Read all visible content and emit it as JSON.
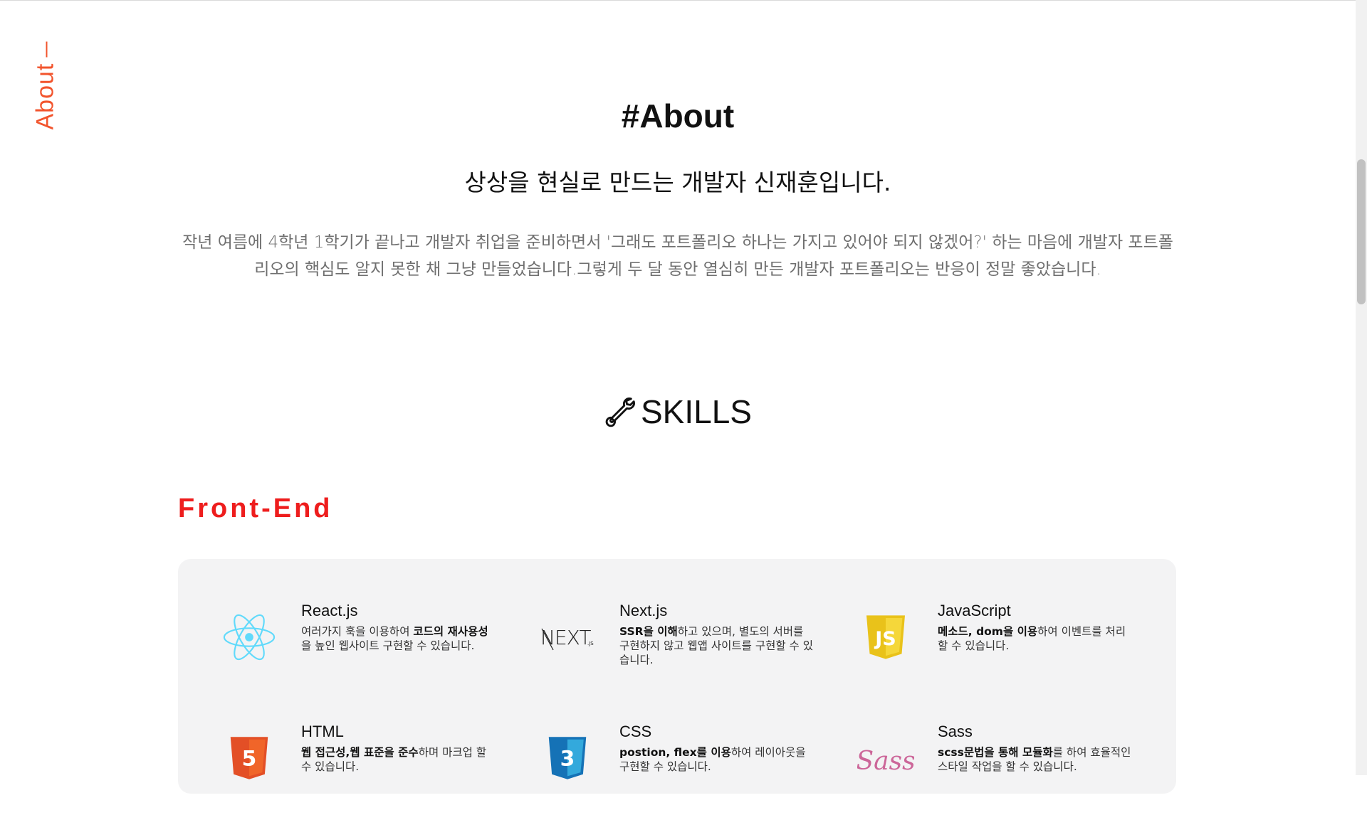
{
  "side_nav": {
    "label": "About"
  },
  "about": {
    "title": "#About",
    "subtitle": "상상을 현실로 만드는 개발자 신재훈입니다.",
    "description": "작년 여름에 4학년 1학기가 끝나고 개발자 취업을 준비하면서 '그래도 포트폴리오 하나는 가지고 있어야 되지 않겠어?' 하는 마음에 개발자 포트폴리오의 핵심도 알지 못한 채 그냥 만들었습니다.그렇게 두 달 동안 열심히 만든 개발자 포트폴리오는 반응이 정말 좋았습니다."
  },
  "skills": {
    "title": "SKILLS",
    "icon": "wrench-icon",
    "front_end_title": "Front-End",
    "items": [
      {
        "name": "React.js",
        "icon": "react-icon",
        "desc_parts": [
          {
            "text": "여러가지 훅을 이용하여 ",
            "bold": false
          },
          {
            "text": "코드의 재사용성",
            "bold": true
          },
          {
            "text": "을 높인 웹사이트 구현할 수 있습니다.",
            "bold": false
          }
        ]
      },
      {
        "name": "Next.js",
        "icon": "nextjs-icon",
        "desc_parts": [
          {
            "text": "SSR을 이해",
            "bold": true
          },
          {
            "text": "하고 있으며, 별도의 서버를 구현하지 않고 웹앱 사이트를 구현할 수 있습니다.",
            "bold": false
          }
        ]
      },
      {
        "name": "JavaScript",
        "icon": "javascript-icon",
        "desc_parts": [
          {
            "text": "메소드, dom을 이용",
            "bold": true
          },
          {
            "text": "하여 이벤트를 처리할 수 있습니다.",
            "bold": false
          }
        ]
      },
      {
        "name": "HTML",
        "icon": "html5-icon",
        "desc_parts": [
          {
            "text": "웹 접근성,웹 표준을 준수",
            "bold": true
          },
          {
            "text": "하며 마크업 할 수 있습니다.",
            "bold": false
          }
        ]
      },
      {
        "name": "CSS",
        "icon": "css3-icon",
        "desc_parts": [
          {
            "text": "postion, flex를 이용",
            "bold": true
          },
          {
            "text": "하여 레이아웃을 구현할 수 있습니다.",
            "bold": false
          }
        ]
      },
      {
        "name": "Sass",
        "icon": "sass-icon",
        "desc_parts": [
          {
            "text": "scss문법을 통해 모듈화",
            "bold": true
          },
          {
            "text": "를 하여 효율적인 스타일 작업을 할 수 있습니다.",
            "bold": false
          }
        ]
      }
    ]
  },
  "colors": {
    "accent_orange": "#f2542d",
    "front_end_red": "#ee1d1d",
    "panel_bg": "#f3f3f4",
    "react_blue": "#61dafb",
    "js_yellow": "#f0db4f",
    "html_orange": "#e34f26",
    "css_blue": "#1572b6",
    "sass_pink": "#cc6699"
  }
}
